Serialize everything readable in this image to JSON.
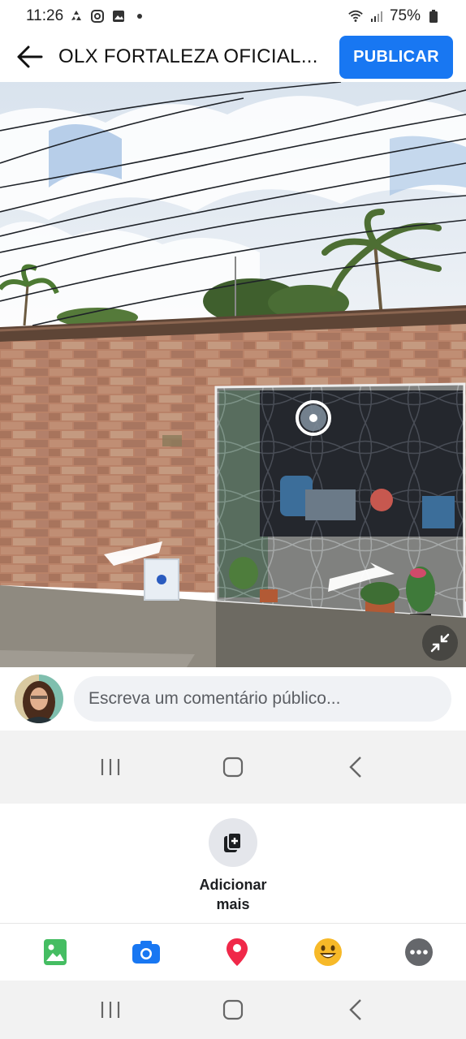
{
  "status_bar": {
    "time": "11:26",
    "battery": "75%",
    "icons": [
      "recycle-icon",
      "instagram-icon",
      "gallery-icon",
      "dot-icon",
      "wifi-icon",
      "signal-icon",
      "battery-icon"
    ]
  },
  "header": {
    "title": "OLX FORTALEZA OFICIAL...",
    "publish_label": "PUBLICAR",
    "accent_color": "#1877f2"
  },
  "photo": {
    "description_icon": "street-view-photo"
  },
  "comment": {
    "placeholder": "Escreva um comentário público..."
  },
  "add_more": {
    "label": "Adicionar mais"
  },
  "attachments": [
    {
      "icon": "photo-icon",
      "color": "#45bd62"
    },
    {
      "icon": "camera-icon",
      "color": "#1877f2"
    },
    {
      "icon": "location-pin-icon",
      "color": "#f02849"
    },
    {
      "icon": "emoji-icon",
      "color": "#f7b928"
    },
    {
      "icon": "more-icon",
      "color": "#65676b"
    }
  ],
  "navigation": [
    "recent-apps-icon",
    "home-icon",
    "back-nav-icon"
  ]
}
